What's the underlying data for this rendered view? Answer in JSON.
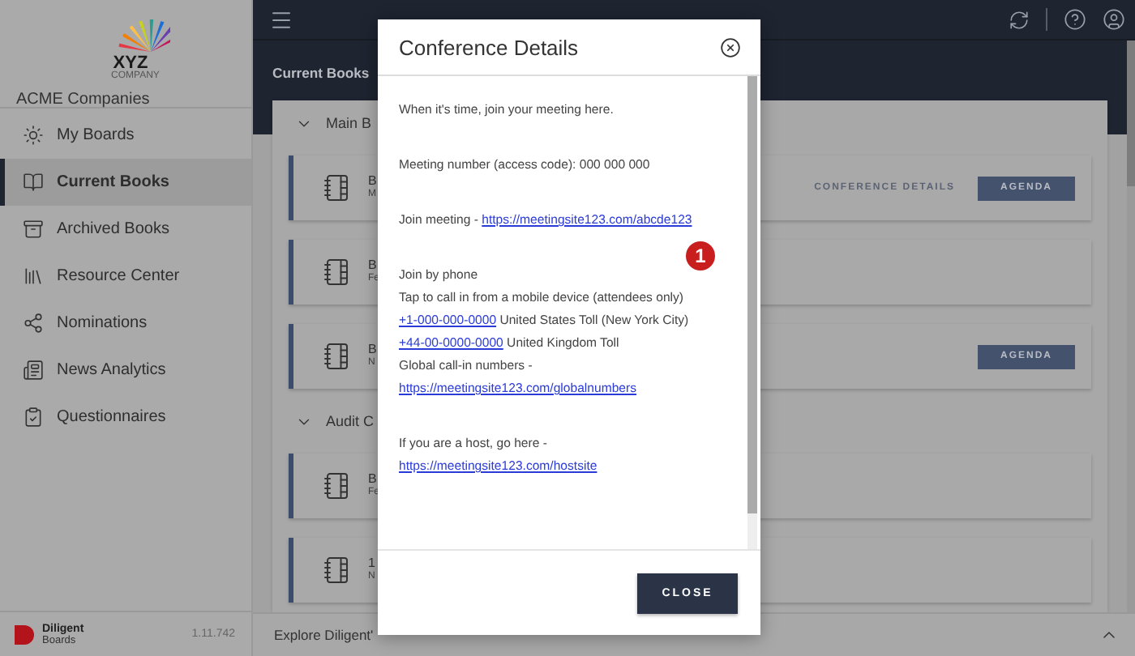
{
  "sidebar": {
    "logo": {
      "line_1": "XYZ",
      "line_2": "COMPANY"
    },
    "org_name": "ACME Companies",
    "items": [
      {
        "label": "My Boards",
        "kind": "hub",
        "selected": false
      },
      {
        "label": "Current Books",
        "kind": "book",
        "selected": true
      },
      {
        "label": "Archived Books",
        "kind": "archive",
        "selected": false
      },
      {
        "label": "Resource Center",
        "kind": "library",
        "selected": false
      },
      {
        "label": "Nominations",
        "kind": "share",
        "selected": false
      },
      {
        "label": "News Analytics",
        "kind": "news",
        "selected": false
      },
      {
        "label": "Questionnaires",
        "kind": "clipboard",
        "selected": false
      }
    ],
    "footer": {
      "brand_line_1": "Diligent",
      "brand_line_2": "Boards",
      "version": "1.11.742"
    }
  },
  "page": {
    "title": "Current Books",
    "sections": [
      {
        "title": "Main B",
        "expanded": true,
        "cards": [
          {
            "title": "B",
            "subtitle": "M",
            "actions": [
              {
                "kind": "link",
                "label": "CONFERENCE DETAILS"
              },
              {
                "kind": "button",
                "label": "AGENDA"
              }
            ]
          },
          {
            "title": "B",
            "subtitle": "Fe"
          },
          {
            "title": "B",
            "subtitle": "N",
            "actions": [
              {
                "kind": "button",
                "label": "AGENDA"
              }
            ]
          }
        ]
      },
      {
        "title": "Audit C",
        "expanded": true,
        "cards": [
          {
            "title": "B",
            "subtitle": "Fe"
          },
          {
            "title": "1",
            "subtitle": "N"
          }
        ]
      }
    ]
  },
  "footer_bar": {
    "text": "Explore Diligent'"
  },
  "dialog": {
    "title": "Conference Details",
    "badge": "1",
    "close_label": "CLOSE",
    "paragraphs": [
      [
        [
          {
            "kind": "text",
            "text": "When it's time, join your meeting here."
          }
        ]
      ],
      [
        [
          {
            "kind": "text",
            "text": "Meeting number (access code): 000 000 000"
          }
        ]
      ],
      [
        [
          {
            "kind": "text",
            "text": "Join meeting - "
          },
          {
            "kind": "link",
            "text": "https://meetingsite123.com/abcde123"
          }
        ]
      ],
      [
        [
          {
            "kind": "text",
            "text": "Join by phone"
          }
        ],
        [
          {
            "kind": "text",
            "text": "Tap to call in from a mobile device (attendees only)"
          }
        ],
        [
          {
            "kind": "link",
            "text": "+1-000-000-0000"
          },
          {
            "kind": "text",
            "text": " United States Toll (New York City)"
          }
        ],
        [
          {
            "kind": "link",
            "text": "+44-00-0000-0000"
          },
          {
            "kind": "text",
            "text": " United Kingdom Toll"
          }
        ],
        [
          {
            "kind": "text",
            "text": "Global call-in numbers -"
          }
        ],
        [
          {
            "kind": "link",
            "text": "https://meetingsite123.com/globalnumbers"
          }
        ]
      ],
      [
        [
          {
            "kind": "text",
            "text": "If you are a host, go here -"
          }
        ],
        [
          {
            "kind": "link",
            "text": "https://meetingsite123.com/hostsite"
          }
        ]
      ]
    ]
  }
}
